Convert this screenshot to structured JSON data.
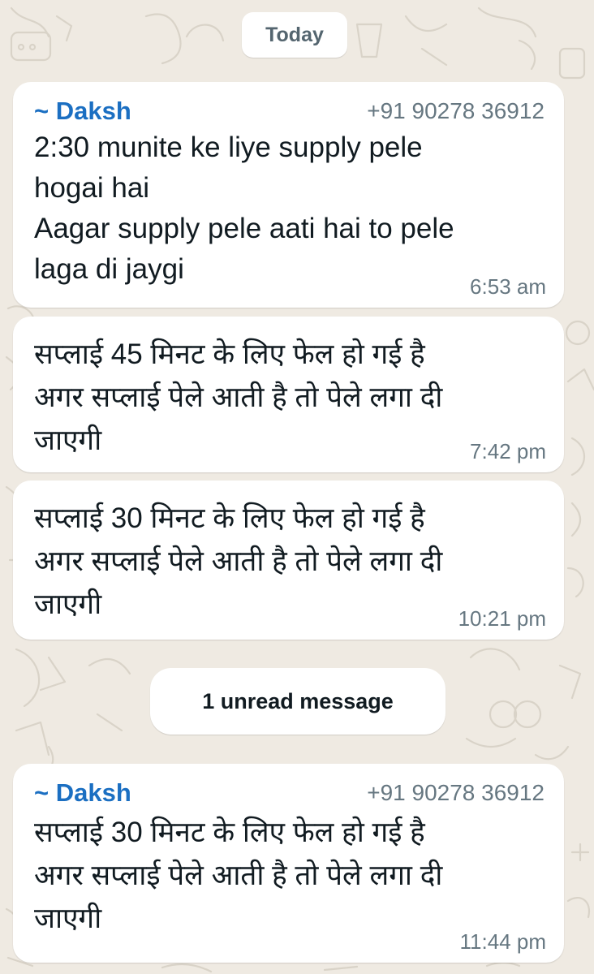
{
  "chat": {
    "date_divider": "Today",
    "unread_divider": "1 unread message",
    "messages": [
      {
        "sender_name": "~ Daksh",
        "sender_phone": "+91 90278 36912",
        "text": "2:30 munite ke liye supply pele\nhogai hai\nAagar supply pele aati hai to pele\nlaga di jaygi",
        "time": "6:53 am"
      },
      {
        "text": "सप्लाई 45 मिनट के लिए फेल हो गई है\nअगर सप्लाई पेले आती है तो पेले लगा दी\nजाएगी",
        "time": "7:42 pm"
      },
      {
        "text": "सप्लाई 30 मिनट के लिए फेल हो गई है\nअगर सप्लाई पेले आती है तो पेले लगा दी\nजाएगी",
        "time": "10:21 pm"
      },
      {
        "sender_name": "~ Daksh",
        "sender_phone": "+91 90278 36912",
        "text": "सप्लाई 30 मिनट के लिए फेल हो गई है\nअगर सप्लाई पेले आती है तो पेले लगा दी\nजाएगी",
        "time": "11:44 pm"
      }
    ]
  },
  "colors": {
    "wallpaper": "#efeae2",
    "bubble": "#ffffff",
    "sender_name": "#1b6fc2",
    "meta_text": "#667781",
    "message_text": "#111b21"
  }
}
